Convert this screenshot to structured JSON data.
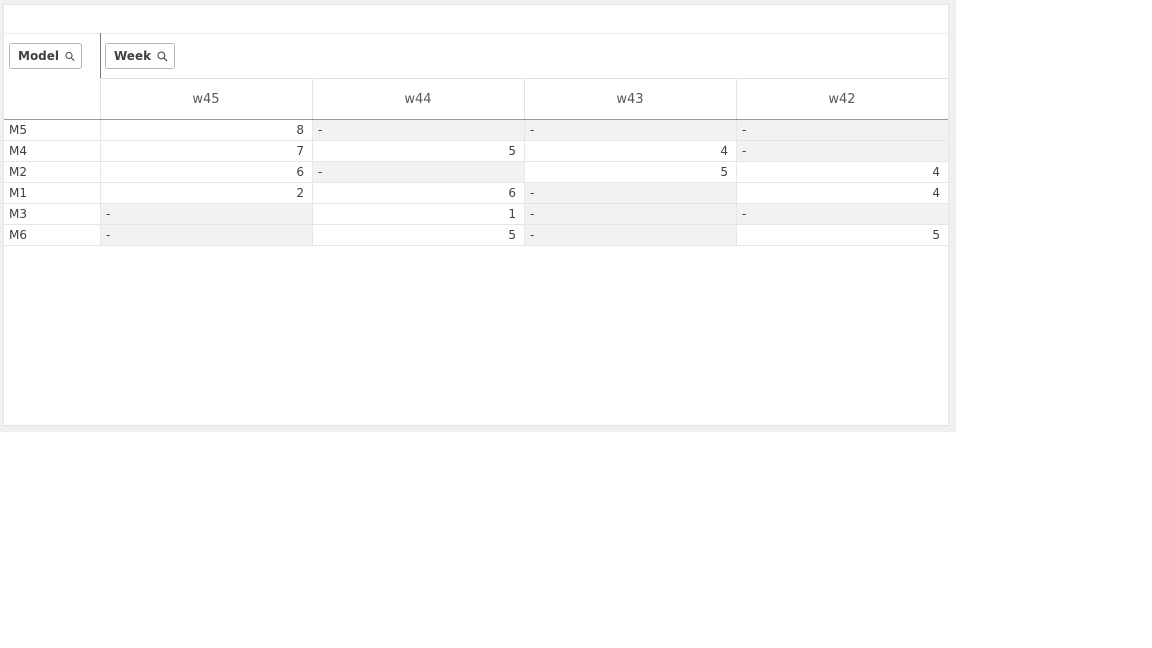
{
  "pivot": {
    "row_dimension": "Model",
    "column_dimension": "Week",
    "columns": [
      "w45",
      "w44",
      "w43",
      "w42"
    ],
    "rows": [
      {
        "label": "M5",
        "values": [
          "8",
          "-",
          "-",
          "-"
        ]
      },
      {
        "label": "M4",
        "values": [
          "7",
          "5",
          "4",
          "-"
        ]
      },
      {
        "label": "M2",
        "values": [
          "6",
          "-",
          "5",
          "4"
        ]
      },
      {
        "label": "M1",
        "values": [
          "2",
          "6",
          "-",
          "4"
        ]
      },
      {
        "label": "M3",
        "values": [
          "-",
          "1",
          "-",
          "-"
        ]
      },
      {
        "label": "M6",
        "values": [
          "-",
          "5",
          "-",
          "5"
        ]
      }
    ]
  },
  "icons": {
    "dimension_search": "search-icon"
  }
}
